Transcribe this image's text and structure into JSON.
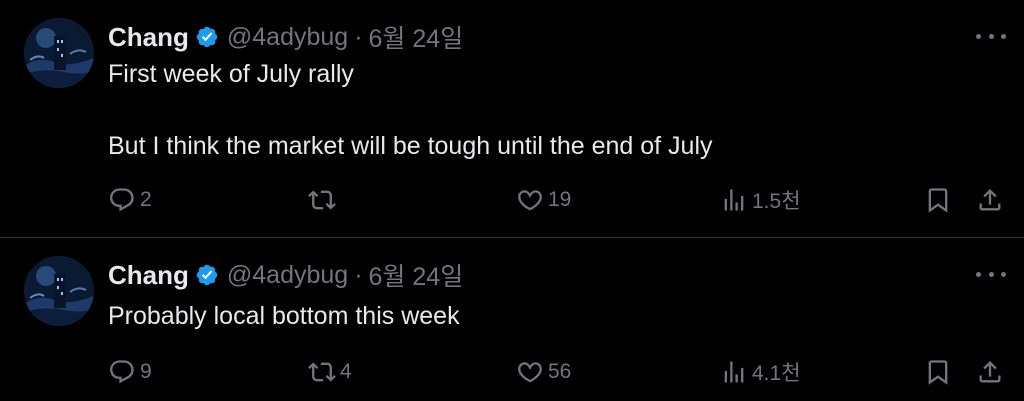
{
  "tweets": [
    {
      "author": {
        "name": "Chang",
        "handle": "@4adybug",
        "verified": true
      },
      "date": "6월 24일",
      "separator": "·",
      "text": "First week of July rally\n\nBut I think the market will be tough until the end of July",
      "actions": {
        "reply_count": "2",
        "retweet_count": "",
        "like_count": "19",
        "views_count": "1.5천"
      }
    },
    {
      "author": {
        "name": "Chang",
        "handle": "@4adybug",
        "verified": true
      },
      "date": "6월 24일",
      "separator": "·",
      "text": "Probably local bottom this week",
      "actions": {
        "reply_count": "9",
        "retweet_count": "4",
        "like_count": "56",
        "views_count": "4.1천"
      }
    }
  ],
  "icons": {
    "verified": "verified-badge-icon",
    "more": "more-options-icon",
    "reply": "reply-icon",
    "retweet": "retweet-icon",
    "like": "heart-icon",
    "views": "views-chart-icon",
    "bookmark": "bookmark-icon",
    "share": "share-icon"
  },
  "colors": {
    "background": "#000000",
    "text": "#e7e9ea",
    "muted": "#71767b",
    "verified": "#1d9bf0",
    "divider": "#2f3336"
  }
}
